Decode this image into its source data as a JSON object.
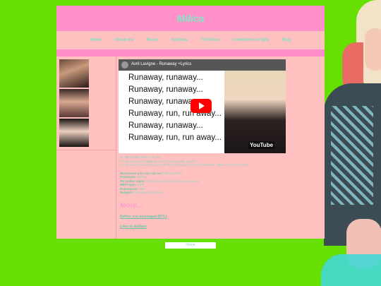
{
  "site": {
    "title": "Milica"
  },
  "nav": {
    "items": [
      "Home",
      "About me",
      "Music",
      "Hobbies",
      "TV/Series",
      "Collections of gifs",
      "Blog"
    ]
  },
  "video": {
    "title": "Avril Lavigne - Runaway +Lyrics",
    "lyrics": [
      "Runaway, runaway...",
      "Runaway, runaway...",
      "Runaway, runaway...",
      "Runaway, run, run away...",
      "Runaway, runaway...",
      "Runaway, run, run away..."
    ],
    "logo": "YouTube"
  },
  "intro": {
    "line1": "Hi! My name's Milica. I'm 16.",
    "line2": "I'm the owner of Milifa5 and this is my website. Enjoy ^_^",
    "line3": "I'm the one who will show you all the cool things I like in my website. Have a nice time here!"
  },
  "facts": [
    {
      "label": "Nicknames you can call me:",
      "value": "Mili and Mica"
    },
    {
      "label": "Pronouns:",
      "value": "she/her"
    },
    {
      "label": "My zodiac signs:",
      "value": "Gemini sun, Scorpio rising, Leo moon"
    },
    {
      "label": "MBTI type:",
      "value": "INFP"
    },
    {
      "label": "Enneagram:",
      "value": "4w5"
    },
    {
      "label": "Religion:",
      "value": "Christian (Orthodox)"
    }
  ],
  "more_heading": "More...",
  "links": {
    "first": "Before you messaged (RTL)",
    "second": "Likes & dislikes"
  },
  "footer": {
    "home_button": "Home"
  },
  "colors": {
    "background": "#66e000",
    "page": "#ffc0c0",
    "header": "#ff91c8",
    "accent_text": "#7fe8c8"
  }
}
